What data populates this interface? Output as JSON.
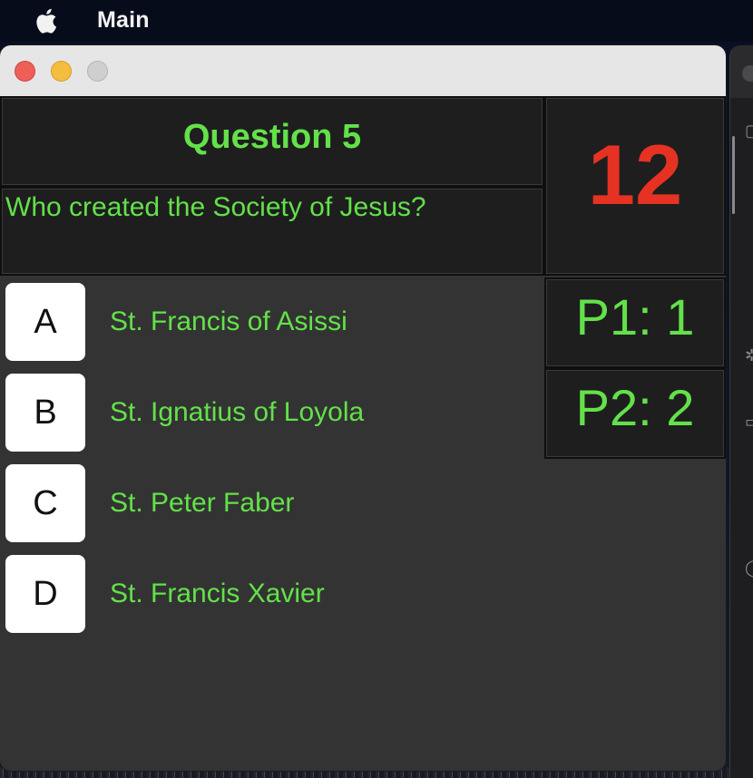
{
  "menubar": {
    "app_name": "Main"
  },
  "quiz": {
    "question_title": "Question 5",
    "question_text": "Who created the Society of Jesus?",
    "timer": "12",
    "scores": {
      "p1": "P1: 1",
      "p2": "P2: 2"
    },
    "answers": [
      {
        "letter": "A",
        "text": "St. Francis of Asissi"
      },
      {
        "letter": "B",
        "text": "St. Ignatius of Loyola"
      },
      {
        "letter": "C",
        "text": "St. Peter Faber"
      },
      {
        "letter": "D",
        "text": "St. Francis Xavier"
      }
    ]
  },
  "colors": {
    "accent_green": "#63e14a",
    "timer_red": "#e53223",
    "window_bg": "#333333",
    "panel_bg": "#1e1e1e"
  }
}
